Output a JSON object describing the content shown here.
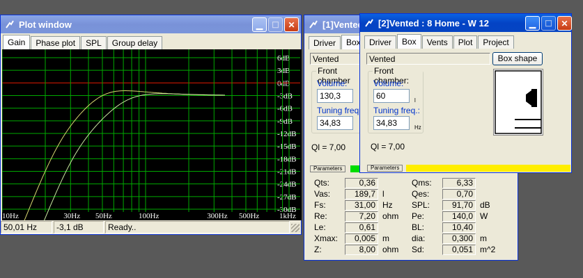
{
  "plot_window": {
    "title": "Plot window",
    "tabs": [
      "Gain",
      "Phase plot",
      "SPL",
      "Group delay"
    ],
    "status": [
      "50,01 Hz",
      "-3,1 dB",
      "Ready.."
    ]
  },
  "plot": {
    "y_ticks": [
      "6dB",
      "3dB",
      "0dB",
      "-3dB",
      "-6dB",
      "-9dB",
      "-12dB",
      "-15dB",
      "-18dB",
      "-21dB",
      "-24dB",
      "-27dB",
      "-30dB"
    ],
    "x_ticks": [
      "10Hz",
      "30Hz",
      "50Hz",
      "100Hz",
      "300Hz",
      "500Hz",
      "1kHz"
    ],
    "colors": {
      "background": "#000000",
      "grid": "#00aa00",
      "zero_line": "#cc0000",
      "curve_1": "#d8d870",
      "curve_2": "#c8e8a0"
    }
  },
  "vented1": {
    "title": "[1]Vented",
    "tabs": [
      "Driver",
      "Box"
    ],
    "box_type": "Vented",
    "front_chamber": "Front chamber",
    "volume_label": "Volume:",
    "volume_value": "130,3",
    "tuning_label": "Tuning freq.:",
    "tuning_value": "34,83",
    "ql": "Ql = 7,00",
    "params_tab": "Parameters"
  },
  "vented2": {
    "title": "[2]Vented : 8 Home - W 12",
    "tabs": [
      "Driver",
      "Box",
      "Vents",
      "Plot",
      "Project"
    ],
    "box_type": "Vented",
    "box_shape_button": "Box shape",
    "front_chamber": "Front chamber:",
    "volume_label": "Volume:",
    "volume_value": "60",
    "volume_unit": "l",
    "tuning_label": "Tuning freq.:",
    "tuning_value": "34,83",
    "tuning_unit": "Hz",
    "ql": "Ql = 7,00",
    "params_tab": "Parameters",
    "accent": "#ffee00"
  },
  "parameters": {
    "left": [
      {
        "name": "Qts:",
        "value": "0,36",
        "unit": ""
      },
      {
        "name": "Vas:",
        "value": "189,7",
        "unit": "l"
      },
      {
        "name": "Fs:",
        "value": "31,00",
        "unit": "Hz"
      },
      {
        "name": "Re:",
        "value": "7,20",
        "unit": "ohm"
      },
      {
        "name": "Le:",
        "value": "0,61",
        "unit": ""
      },
      {
        "name": "Xmax:",
        "value": "0,005",
        "unit": "m"
      },
      {
        "name": "Z:",
        "value": "8,00",
        "unit": "ohm"
      }
    ],
    "right": [
      {
        "name": "Qms:",
        "value": "6,33",
        "unit": ""
      },
      {
        "name": "Qes:",
        "value": "0,70",
        "unit": ""
      },
      {
        "name": "SPL:",
        "value": "91,70",
        "unit": "dB"
      },
      {
        "name": "Pe:",
        "value": "140,0",
        "unit": "W"
      },
      {
        "name": "BL:",
        "value": "10,40",
        "unit": ""
      },
      {
        "name": "dia:",
        "value": "0,300",
        "unit": "m"
      },
      {
        "name": "Sd:",
        "value": "0,051",
        "unit": "m^2"
      }
    ]
  }
}
